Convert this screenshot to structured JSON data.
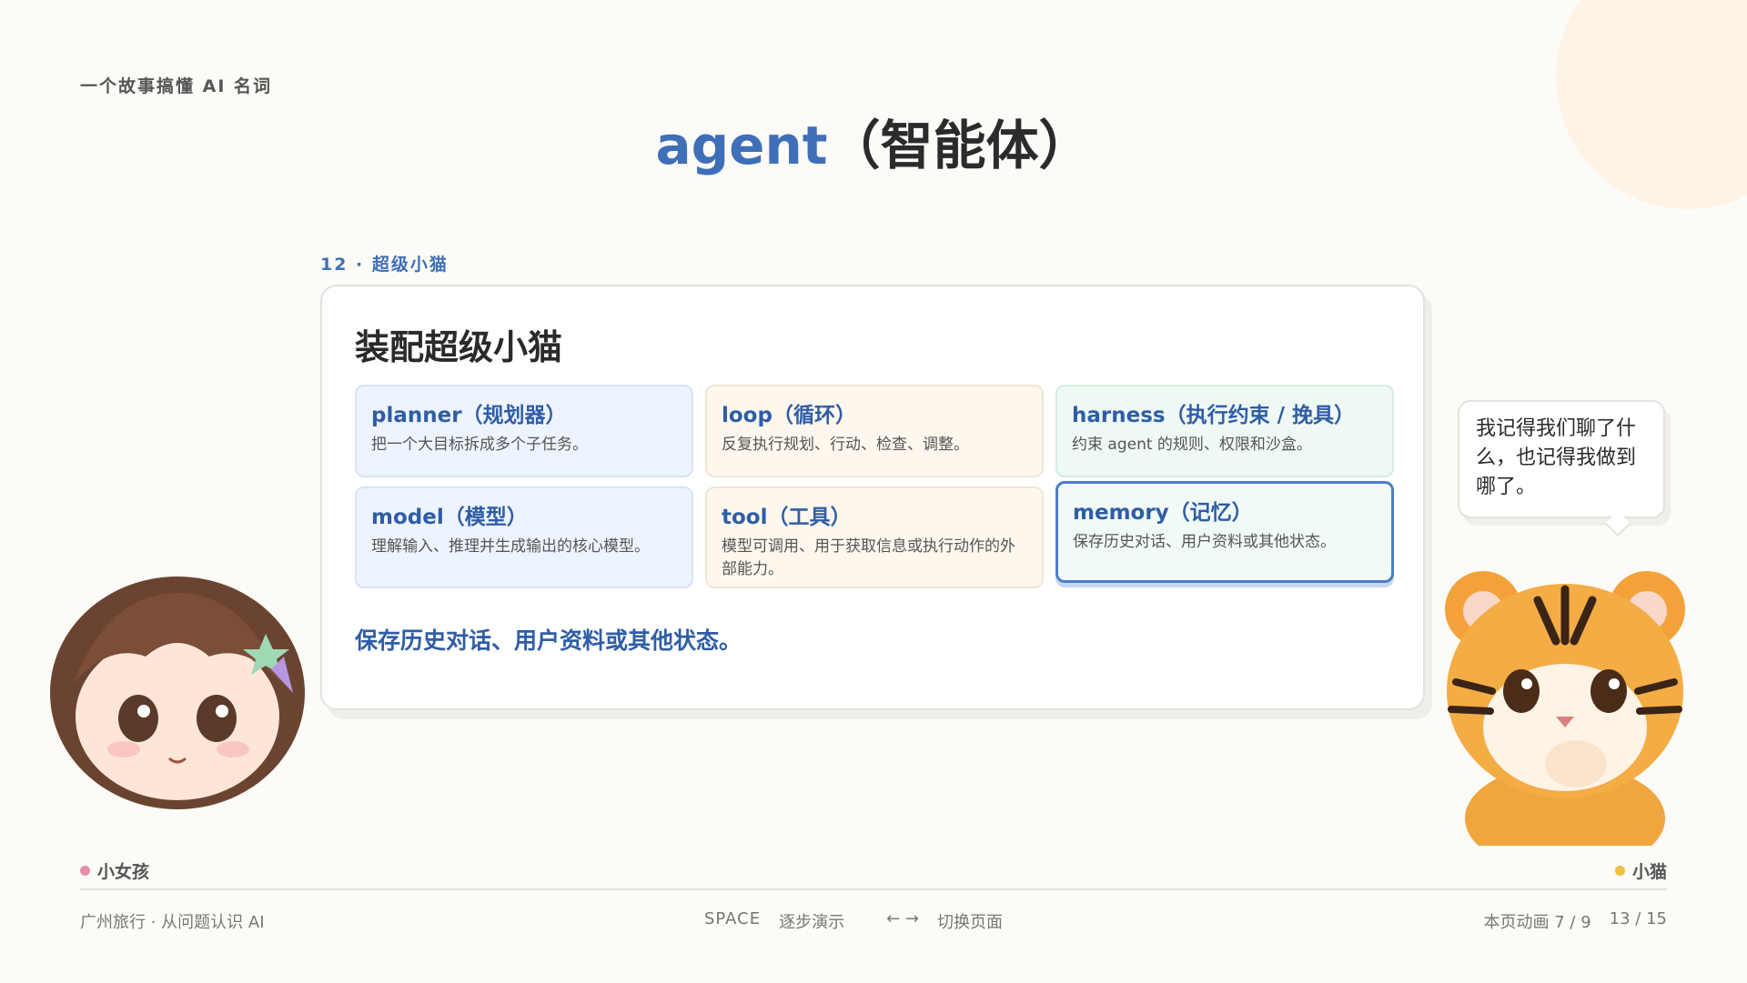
{
  "series_label": "一个故事搞懂 AI 名词",
  "title": {
    "en": "agent",
    "zh": "（智能体）"
  },
  "kicker": "12 · 超级小猫",
  "card": {
    "title": "装配超级小猫",
    "items": [
      {
        "name": "planner（规划器）",
        "desc": "把一个大目标拆成多个子任务。",
        "tone": "blue"
      },
      {
        "name": "loop（循环）",
        "desc": "反复执行规划、行动、检查、调整。",
        "tone": "peach"
      },
      {
        "name": "harness（执行约束 / 挽具）",
        "desc": "约束 agent 的规则、权限和沙盒。",
        "tone": "mint"
      },
      {
        "name": "model（模型）",
        "desc": "理解输入、推理并生成输出的核心模型。",
        "tone": "blue"
      },
      {
        "name": "tool（工具）",
        "desc": "模型可调用、用于获取信息或执行动作的外部能力。",
        "tone": "peach"
      },
      {
        "name": "memory（记忆）",
        "desc": "保存历史对话、用户资料或其他状态。",
        "tone": "mint",
        "active": true
      }
    ],
    "highlight": "保存历史对话、用户资料或其他状态。"
  },
  "bubble_text": "我记得我们聊了什么，也记得我做到哪了。",
  "speakers": {
    "left": {
      "label": "小女孩",
      "color": "#e58fa5"
    },
    "right": {
      "label": "小猫",
      "color": "#f0c23e"
    }
  },
  "footer": {
    "left": "广州旅行 · 从问题认识 AI",
    "space_key": "SPACE",
    "space_action": "逐步演示",
    "arrow_keys": "←  →",
    "arrow_action": "切换页面",
    "animation_progress": "本页动画 7 / 9",
    "page_progress": "13 / 15"
  },
  "colors": {
    "accent": "#3e6fb8",
    "background": "#fcfbf7"
  }
}
